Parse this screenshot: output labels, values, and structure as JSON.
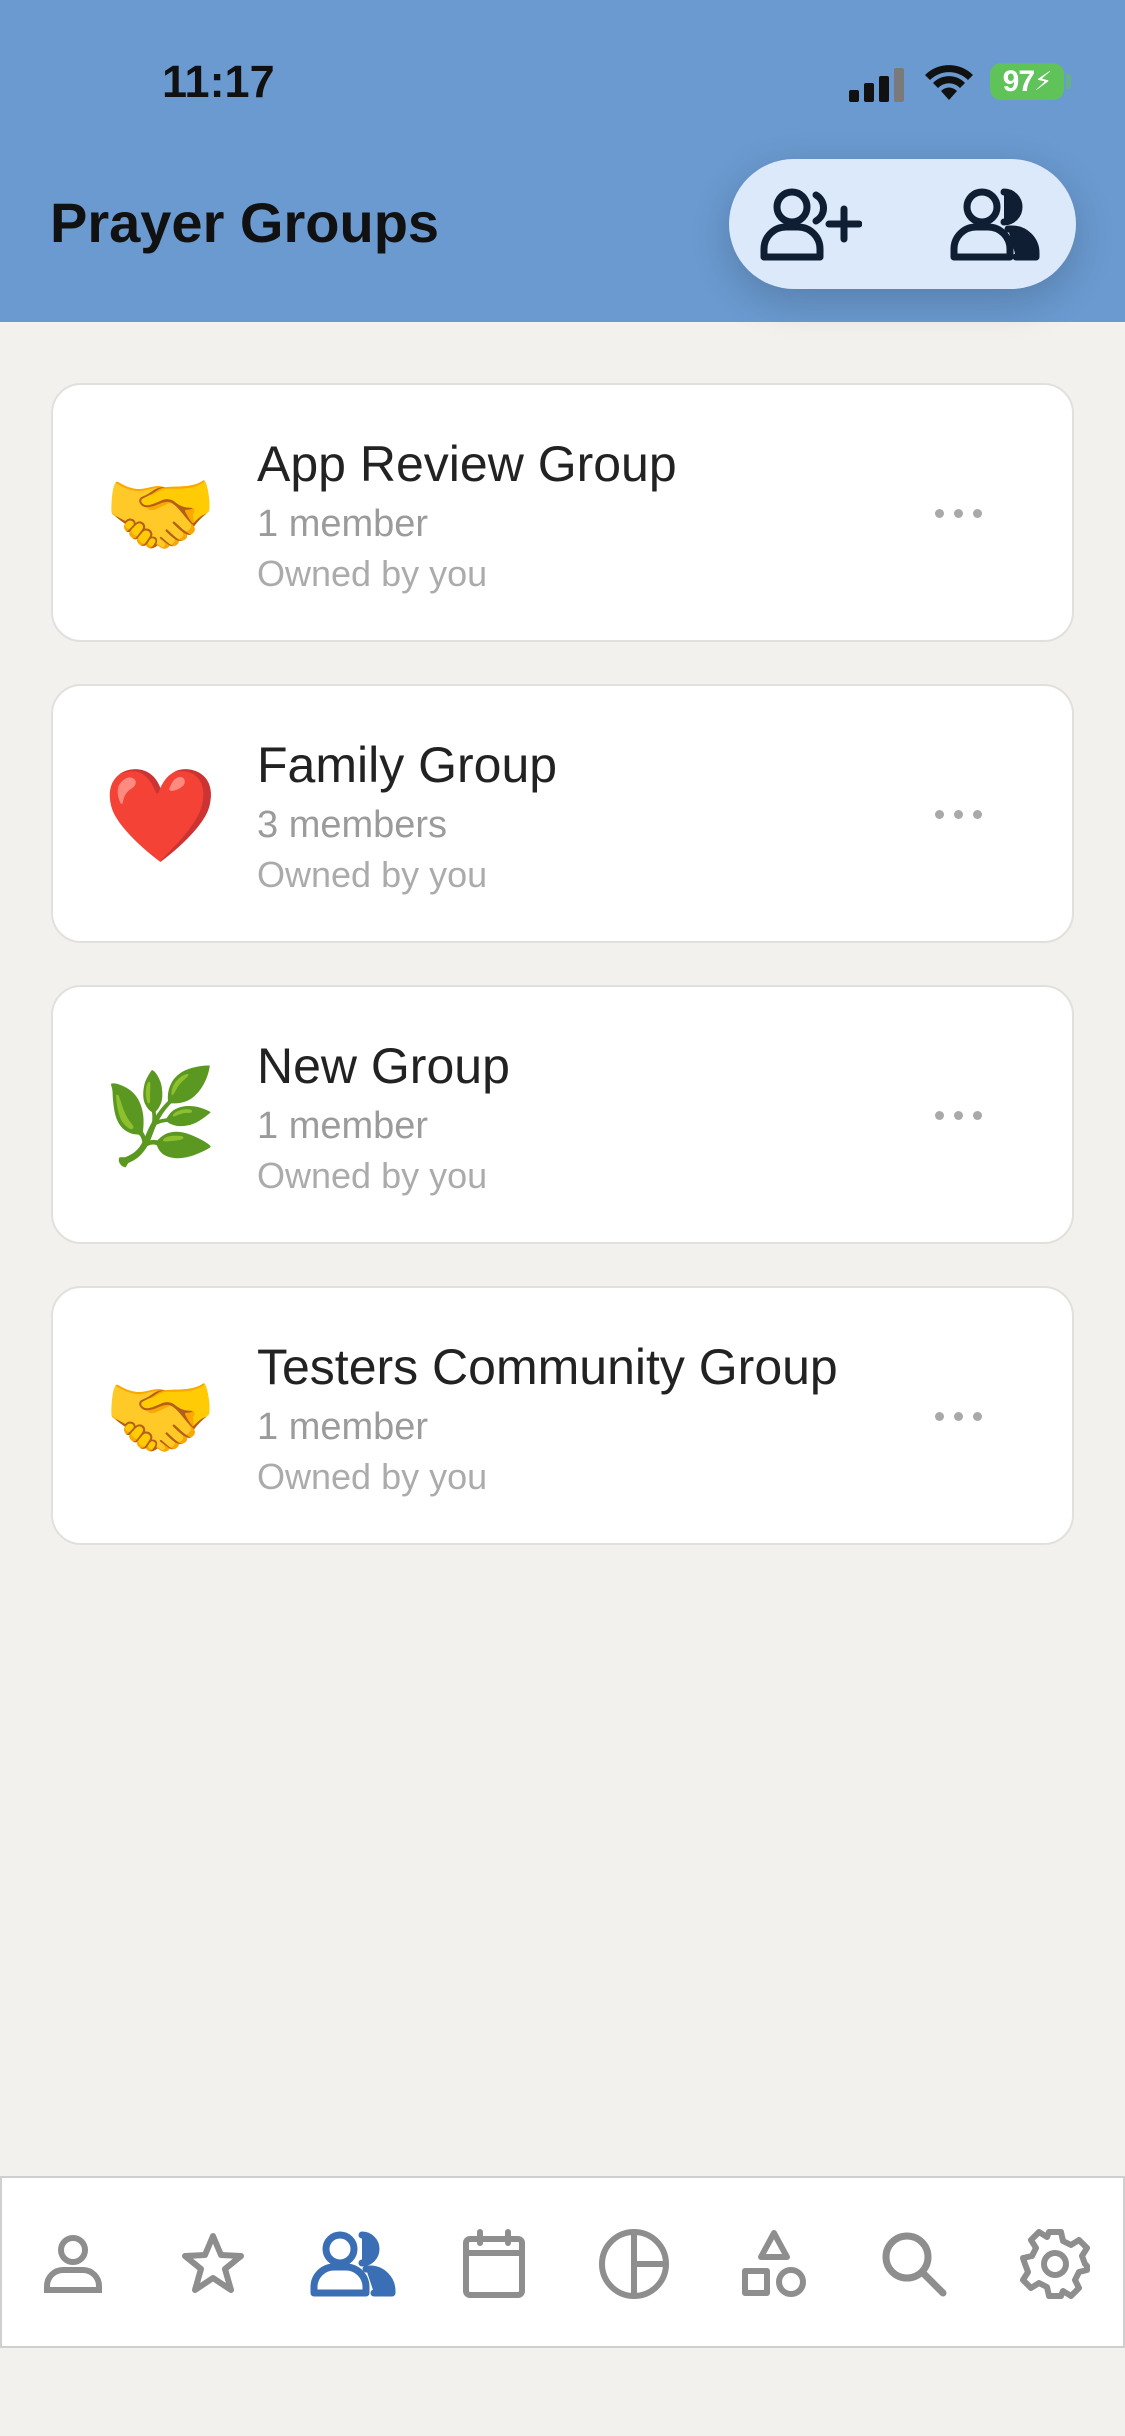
{
  "status": {
    "time": "11:17",
    "battery": "97"
  },
  "header": {
    "title": "Prayer Groups"
  },
  "groups": [
    {
      "emoji": "🤝",
      "name": "App Review Group",
      "members": "1 member",
      "owner": "Owned by you"
    },
    {
      "emoji": "❤️",
      "name": "Family Group",
      "members": "3 members",
      "owner": "Owned by you"
    },
    {
      "emoji": "🌿",
      "name": "New Group",
      "members": "1 member",
      "owner": "Owned by you"
    },
    {
      "emoji": "🤝",
      "name": "Testers Community Group",
      "members": "1 member",
      "owner": "Owned by you"
    }
  ],
  "tabs": [
    {
      "icon": "person-icon"
    },
    {
      "icon": "star-icon"
    },
    {
      "icon": "groups-icon",
      "active": true
    },
    {
      "icon": "calendar-icon"
    },
    {
      "icon": "pie-chart-icon"
    },
    {
      "icon": "shapes-icon"
    },
    {
      "icon": "search-icon"
    },
    {
      "icon": "gear-icon"
    }
  ],
  "colors": {
    "header": "#6a9ad0",
    "active_tab": "#3a6fb5",
    "inactive_tab": "#8e8e8e",
    "background": "#f3f1ed"
  }
}
